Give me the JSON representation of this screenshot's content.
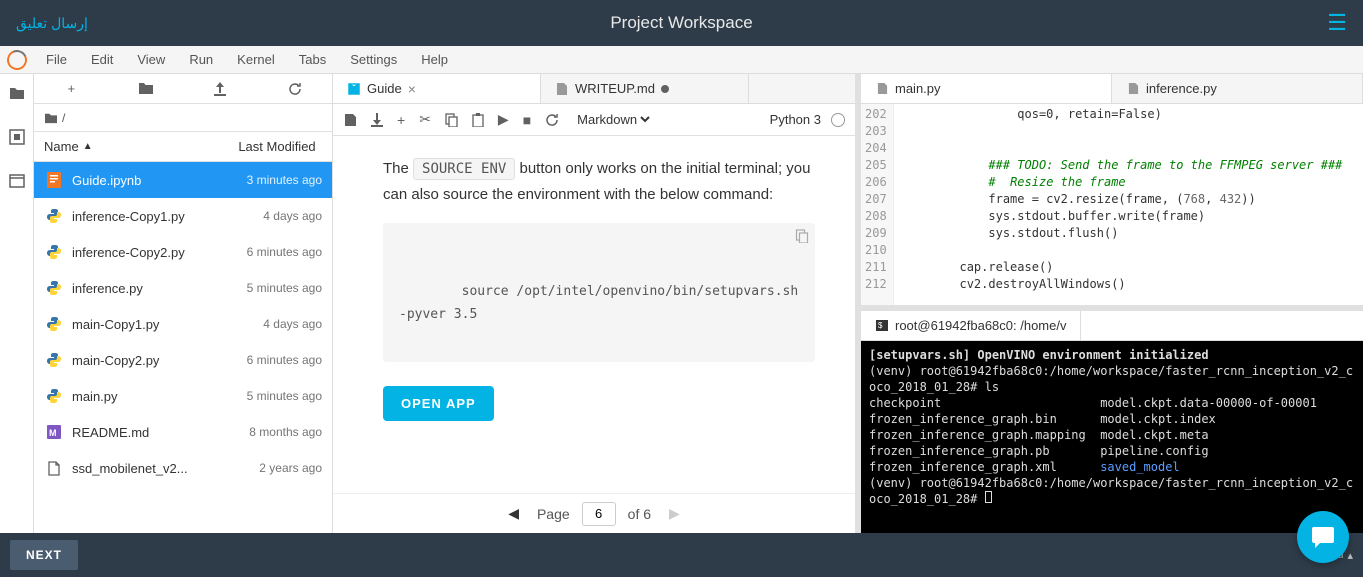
{
  "topbar": {
    "feedback": "إرسال تعليق",
    "title": "Project Workspace"
  },
  "menubar": [
    "File",
    "Edit",
    "View",
    "Run",
    "Kernel",
    "Tabs",
    "Settings",
    "Help"
  ],
  "breadcrumb": "/",
  "fb_header": {
    "name": "Name",
    "mod": "Last Modified"
  },
  "files": [
    {
      "name": "Guide.ipynb",
      "mod": "3 minutes ago",
      "type": "nb",
      "selected": true
    },
    {
      "name": "inference-Copy1.py",
      "mod": "4 days ago",
      "type": "py"
    },
    {
      "name": "inference-Copy2.py",
      "mod": "6 minutes ago",
      "type": "py"
    },
    {
      "name": "inference.py",
      "mod": "5 minutes ago",
      "type": "py"
    },
    {
      "name": "main-Copy1.py",
      "mod": "4 days ago",
      "type": "py"
    },
    {
      "name": "main-Copy2.py",
      "mod": "6 minutes ago",
      "type": "py"
    },
    {
      "name": "main.py",
      "mod": "5 minutes ago",
      "type": "py"
    },
    {
      "name": "README.md",
      "mod": "8 months ago",
      "type": "md"
    },
    {
      "name": "ssd_mobilenet_v2...",
      "mod": "2 years ago",
      "type": "file"
    }
  ],
  "center_tabs": [
    {
      "label": "Guide",
      "icon": "guide",
      "active": true
    },
    {
      "label": "WRITEUP.md",
      "icon": "md",
      "dirty": true
    }
  ],
  "cell_format": "Markdown",
  "kernel_name": "Python 3",
  "guide_text1": "The ",
  "guide_code_inline": "SOURCE ENV",
  "guide_text2": " button only works on the initial terminal; you can also source the environment with the below command:",
  "codeblock": "source /opt/intel/openvino/bin/setupvars.sh -pyver 3.5",
  "open_app": "OPEN APP",
  "pager": {
    "label": "Page",
    "current": "6",
    "of": "of 6"
  },
  "right_tabs": [
    {
      "label": "main.py",
      "active": true
    },
    {
      "label": "inference.py"
    }
  ],
  "editor_lines": [
    {
      "n": "202",
      "html": "                qos=0, retain=<span class='c-kw'>False</span>)"
    },
    {
      "n": "203",
      "html": ""
    },
    {
      "n": "204",
      "html": ""
    },
    {
      "n": "205",
      "html": "            <span class='c-comm'>### TODO: Send the frame to the FFMPEG server ###</span>"
    },
    {
      "n": "206",
      "html": "            <span class='c-comm'>#  Resize the frame</span>"
    },
    {
      "n": "207",
      "html": "            frame = cv2.resize(frame, (<span class='c-num'>768</span>, <span class='c-num'>432</span>))"
    },
    {
      "n": "208",
      "html": "            sys.stdout.buffer.write(frame)"
    },
    {
      "n": "209",
      "html": "            sys.stdout.flush()"
    },
    {
      "n": "210",
      "html": ""
    },
    {
      "n": "211",
      "html": "        cap.release()"
    },
    {
      "n": "212",
      "html": "        cv2.destroyAllWindows()"
    }
  ],
  "term_tab": "root@61942fba68c0: /home/v",
  "terminal_lines": [
    "<span class='term-bold'>[setupvars.sh] OpenVINO environment initialized</span>",
    "(venv) root@61942fba68c0:/home/workspace/faster_rcnn_inception_v2_coco_2018_01_28# ls",
    "checkpoint                      model.ckpt.data-00000-of-00001",
    "frozen_inference_graph.bin      model.ckpt.index",
    "frozen_inference_graph.mapping  model.ckpt.meta",
    "frozen_inference_graph.pb       pipeline.config",
    "frozen_inference_graph.xml      <span class='term-dir'>saved_model</span>",
    "(venv) root@61942fba68c0:/home/workspace/faster_rcnn_inception_v2_coco_2018_01_28# <span class='cursor'></span>"
  ],
  "next": "NEXT",
  "menu_label": "Menu"
}
